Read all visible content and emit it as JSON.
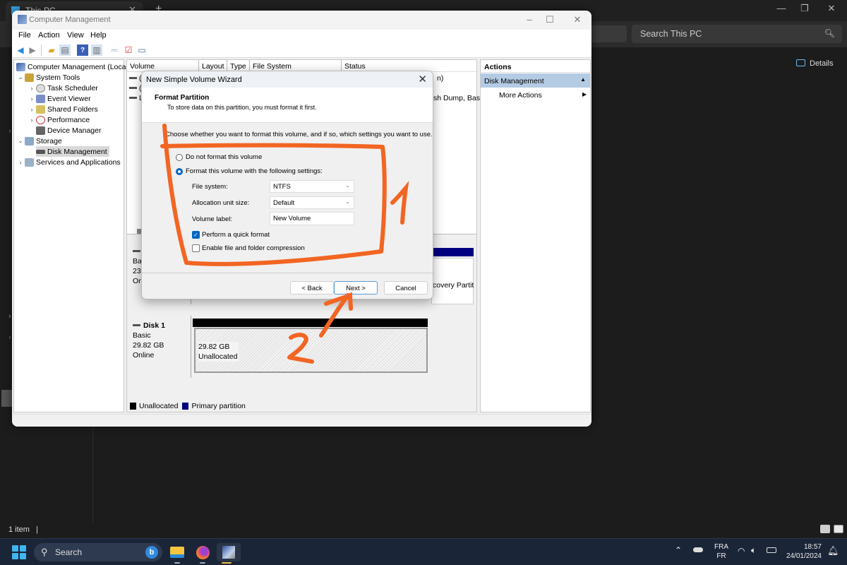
{
  "explorer": {
    "tab_title": "This PC",
    "tab_close": "✕",
    "new_tab": "+",
    "minimize": "—",
    "restore": "❐",
    "close": "✕",
    "search_placeholder": "Search This PC",
    "details_label": "Details",
    "status_items": "1 item",
    "status_sep": "|"
  },
  "window": {
    "title": "Computer Management",
    "minimize": "–",
    "maximize": "☐",
    "close": "✕",
    "menu": [
      "File",
      "Action",
      "View",
      "Help"
    ]
  },
  "tree": {
    "root": "Computer Management (Local)",
    "system_tools": "System Tools",
    "task_scheduler": "Task Scheduler",
    "event_viewer": "Event Viewer",
    "shared_folders": "Shared Folders",
    "performance": "Performance",
    "device_manager": "Device Manager",
    "storage": "Storage",
    "disk_management": "Disk Management",
    "services": "Services and Applications"
  },
  "volumes": {
    "columns": [
      "Volume",
      "Layout",
      "Type",
      "File System",
      "Status"
    ],
    "rows": [
      {
        "prefix": "(",
        "status_tail": "n)"
      },
      {
        "prefix": "(",
        "status_tail": ""
      },
      {
        "prefix": "L",
        "status_tail": "sh Dump, Bas"
      }
    ]
  },
  "disk0": {
    "type": "Bas",
    "size": "23",
    "status": "On",
    "partition_label": "covery Partit"
  },
  "disk1": {
    "name": "Disk 1",
    "type": "Basic",
    "size": "29.82 GB",
    "status": "Online",
    "unallocated_size": "29.82 GB",
    "unallocated_label": "Unallocated"
  },
  "legend": [
    {
      "label": "Unallocated",
      "color": "#000000"
    },
    {
      "label": "Primary partition",
      "color": "#000080"
    }
  ],
  "actions": {
    "header": "Actions",
    "section": "Disk Management",
    "section_arrow": "▲",
    "more": "More Actions",
    "more_arrow": "▶"
  },
  "wizard": {
    "title": "New Simple Volume Wizard",
    "close": "✕",
    "header_title": "Format Partition",
    "header_subtitle": "To store data on this partition, you must format it first.",
    "intro": "Choose whether you want to format this volume, and if so, which settings you want to use.",
    "option_no_format": "Do not format this volume",
    "option_format": "Format this volume with the following settings:",
    "selected_option": "format",
    "file_system_label": "File system:",
    "file_system_value": "NTFS",
    "alloc_label": "Allocation unit size:",
    "alloc_value": "Default",
    "volume_label_label": "Volume label:",
    "volume_label_value": "New Volume",
    "quick_format_label": "Perform a quick format",
    "quick_format_checked": true,
    "compression_label": "Enable file and folder compression",
    "compression_checked": false,
    "back": "< Back",
    "next": "Next >",
    "cancel": "Cancel"
  },
  "annotations": {
    "color": "#f26522",
    "label_1": "1",
    "label_2": "2"
  },
  "taskbar": {
    "search_label": "Search",
    "bing": "b",
    "lang_top": "FRA",
    "lang_bottom": "FR",
    "time": "18:57",
    "date": "24/01/2024"
  }
}
